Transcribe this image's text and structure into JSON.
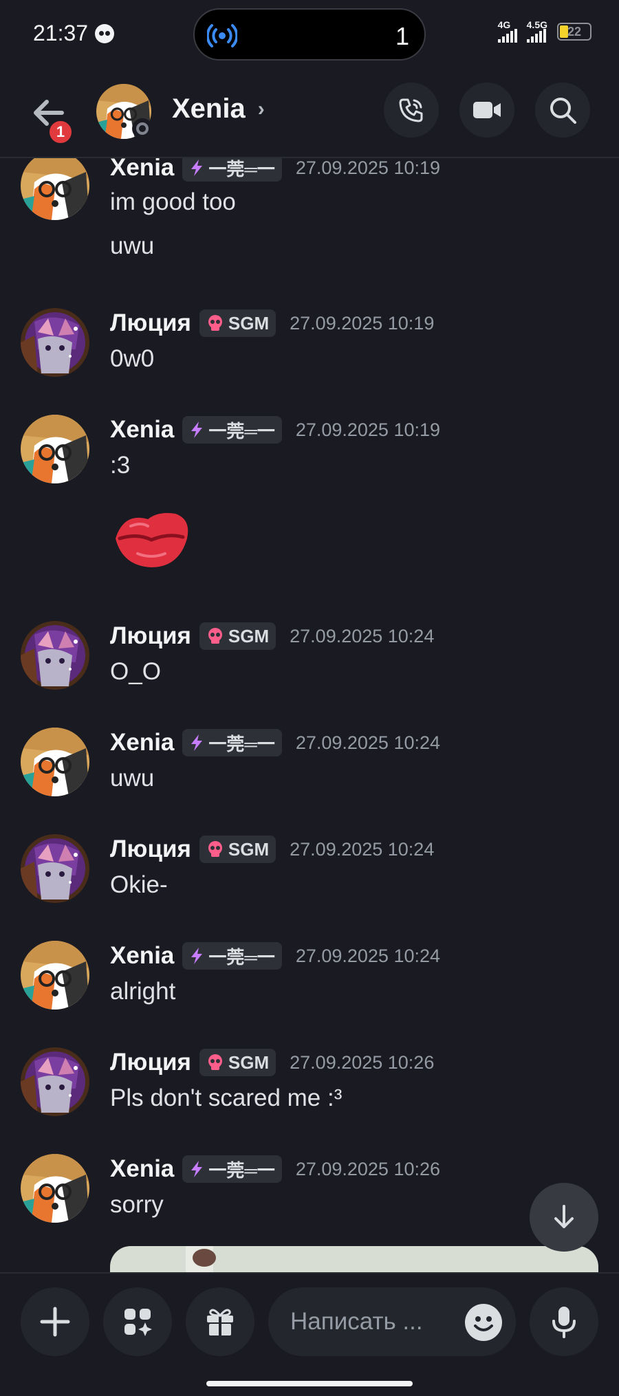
{
  "status_bar": {
    "time": "21:37",
    "island_count": "1",
    "net1": "4G",
    "net2": "4.5G",
    "battery": "22"
  },
  "header": {
    "back_badge": "1",
    "contact_name": "Xenia"
  },
  "tags": {
    "xenia": "一莞═一",
    "lucia": "SGM"
  },
  "messages": [
    {
      "user": "Xenia",
      "tag_kind": "xenia",
      "time": "27.09.2025 10:19",
      "lines": [
        "im good too",
        "uwu"
      ]
    },
    {
      "user": "Люция",
      "tag_kind": "lucia",
      "time": "27.09.2025 10:19",
      "lines": [
        "0w0"
      ]
    },
    {
      "user": "Xenia",
      "tag_kind": "xenia",
      "time": "27.09.2025 10:19",
      "lines": [
        ":3"
      ]
    },
    {
      "user": "Люция",
      "tag_kind": "lucia",
      "time": "27.09.2025 10:24",
      "lines": [
        "O_O"
      ]
    },
    {
      "user": "Xenia",
      "tag_kind": "xenia",
      "time": "27.09.2025 10:24",
      "lines": [
        "uwu"
      ]
    },
    {
      "user": "Люция",
      "tag_kind": "lucia",
      "time": "27.09.2025 10:24",
      "lines": [
        "Okie-"
      ]
    },
    {
      "user": "Xenia",
      "tag_kind": "xenia",
      "time": "27.09.2025 10:24",
      "lines": [
        "alright"
      ]
    },
    {
      "user": "Люция",
      "tag_kind": "lucia",
      "time": "27.09.2025 10:26",
      "lines": [
        "Pls don't scared me :³"
      ]
    },
    {
      "user": "Xenia",
      "tag_kind": "xenia",
      "time": "27.09.2025 10:26",
      "lines": [
        "sorry"
      ]
    }
  ],
  "composer": {
    "placeholder": "Написать ..."
  },
  "icons": {
    "back": "arrow-left-icon",
    "call": "phone-icon",
    "video": "video-camera-icon",
    "search": "search-icon",
    "add": "plus-icon",
    "apps": "apps-sparkle-icon",
    "gift": "gift-icon",
    "emoji": "emoji-icon",
    "mic": "microphone-icon",
    "scroll": "arrow-down-icon",
    "kiss": "kiss-lips-icon"
  },
  "colors": {
    "background": "#1a1b22",
    "accent_blue": "#3b8bf5",
    "badge_red": "#e03a3e",
    "lips_red": "#e0303f"
  }
}
